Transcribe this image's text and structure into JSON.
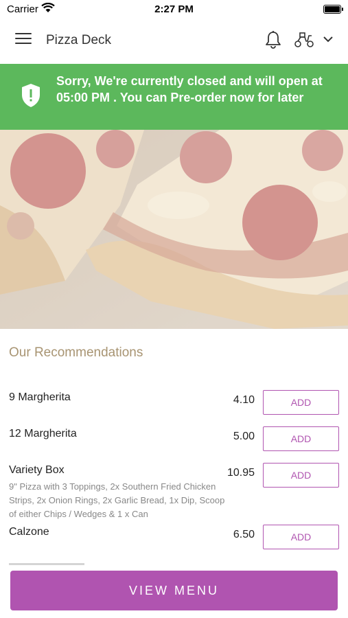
{
  "status": {
    "carrier": "Carrier",
    "time": "2:27 PM"
  },
  "header": {
    "title": "Pizza Deck"
  },
  "banner": {
    "message": "Sorry, We're currently closed and will open at 05:00 PM . You can Pre-order now for later",
    "color": "#5cb85c"
  },
  "recommendations": {
    "title": "Our Recommendations",
    "items": [
      {
        "name": "9 Margherita",
        "desc": "",
        "price": "4.10",
        "action": "ADD"
      },
      {
        "name": "12 Margherita",
        "desc": "",
        "price": "5.00",
        "action": "ADD"
      },
      {
        "name": "Variety Box",
        "desc": "9\" Pizza with 3 Toppings, 2x Southern Fried Chicken Strips, 2x Onion Rings, 2x Garlic Bread, 1x Dip, Scoop of either Chips / Wedges & 1 x Can",
        "price": "10.95",
        "action": "ADD"
      },
      {
        "name": "Calzone",
        "desc": "",
        "price": "6.50",
        "action": "ADD"
      }
    ]
  },
  "footer": {
    "view_menu_label": "VIEW MENU"
  },
  "colors": {
    "accent": "#b054b0",
    "section_title": "#a89472",
    "success": "#5cb85c"
  },
  "icons": [
    "wifi-icon",
    "battery-icon",
    "hamburger-menu-icon",
    "bell-icon",
    "scooter-icon",
    "chevron-down-icon",
    "shield-icon"
  ]
}
